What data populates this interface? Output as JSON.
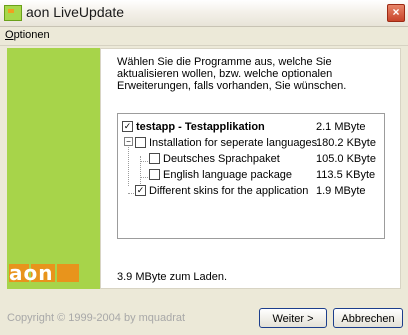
{
  "window": {
    "title": "aon LiveUpdate"
  },
  "menu": {
    "options_label_underlined": "O",
    "options_label_rest": "ptionen"
  },
  "brand": {
    "logo_text": "aon"
  },
  "intro": {
    "text": "Wählen Sie die Programme aus, welche Sie aktualisieren wollen, bzw. welche optionalen Erweiterungen, falls vorhanden, Sie wünschen."
  },
  "tree": {
    "items": [
      {
        "label": "testapp - Testapplikation",
        "size": "2.1 MByte",
        "checked": true
      },
      {
        "label": "Installation for seperate languages",
        "size": "180.2 KByte",
        "checked": false
      },
      {
        "label": "Deutsches Sprachpaket",
        "size": "105.0 KByte",
        "checked": false
      },
      {
        "label": "English language package",
        "size": "113.5 KByte",
        "checked": false
      },
      {
        "label": "Different skins for the application",
        "size": "1.9 MByte",
        "checked": true
      }
    ]
  },
  "status": {
    "load_text": "3.9 MByte zum Laden."
  },
  "footer": {
    "copyright": "Copyright © 1999-2004 by mquadrat"
  },
  "buttons": {
    "next_label": "Weiter >",
    "cancel_label": "Abbrechen"
  }
}
